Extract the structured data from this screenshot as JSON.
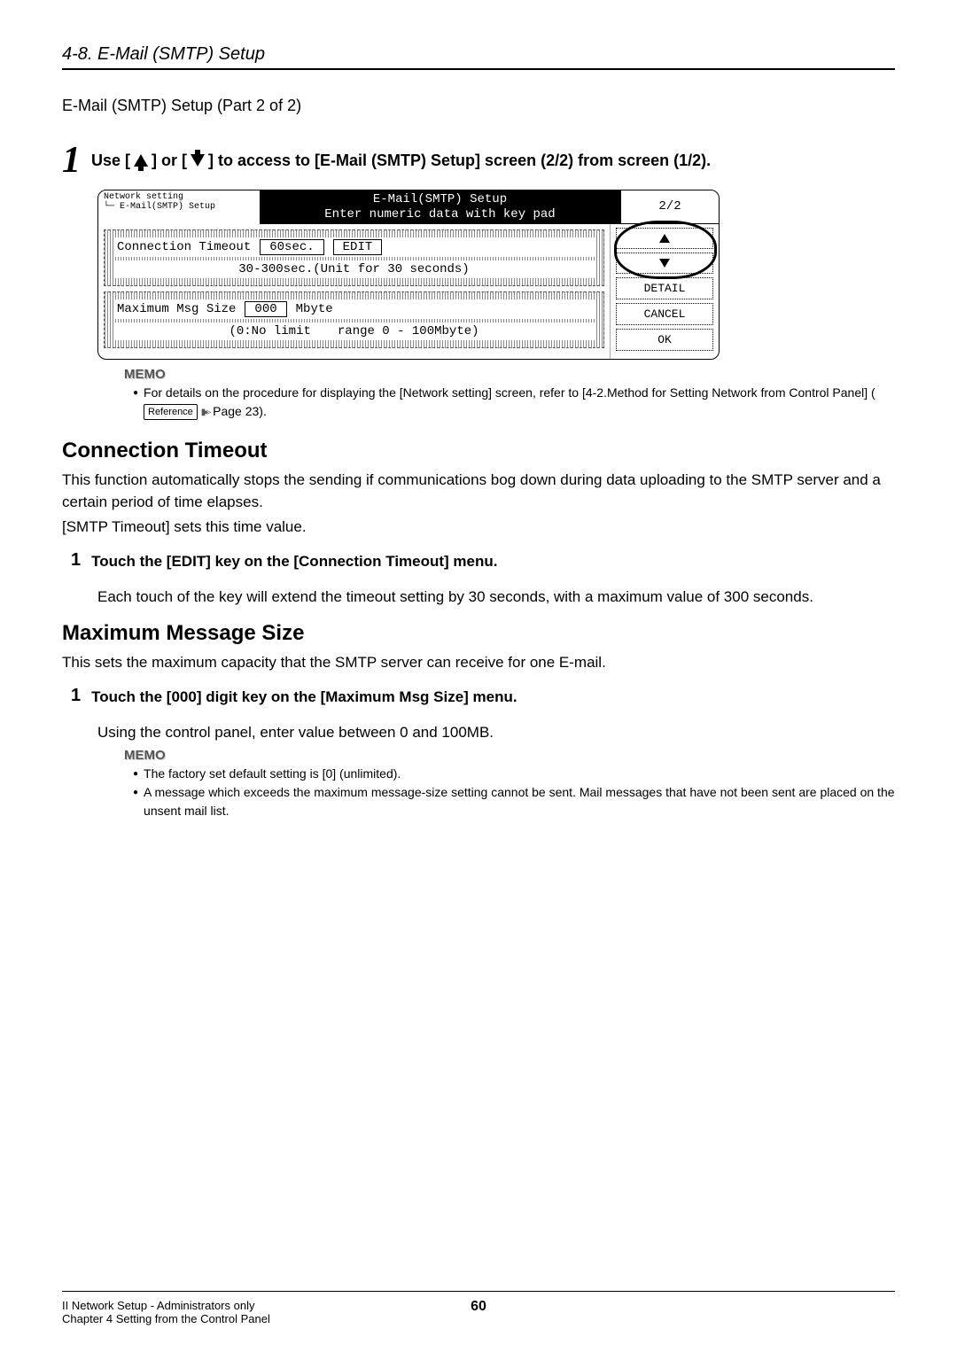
{
  "breadcrumb": "4-8. E-Mail (SMTP) Setup",
  "subtitle": "E-Mail (SMTP) Setup (Part 2 of 2)",
  "step1": {
    "pre": "Use [",
    "mid": "] or [",
    "post": "] to access to [E-Mail (SMTP) Setup] screen (2/2) from screen (1/2)."
  },
  "panel": {
    "header_left_line1": "Network setting",
    "header_left_line2": "└─ E-Mail(SMTP) Setup",
    "header_title_line1": "E-Mail(SMTP) Setup",
    "header_title_line2": "Enter numeric data with key pad",
    "page_indicator": "2/2",
    "row1_label": "Connection Timeout",
    "row1_value": "60sec.",
    "row1_button": "EDIT",
    "row1_hint": "30-300sec.(Unit for 30 seconds)",
    "row2_label": "Maximum Msg Size",
    "row2_value": "000",
    "row2_unit": "Mbyte",
    "row2_hint_left": "(0:No limit",
    "row2_hint_right": "range 0 - 100Mbyte)",
    "side": {
      "detail": "DETAIL",
      "cancel": "CANCEL",
      "ok": "OK"
    }
  },
  "memo1": {
    "label": "MEMO",
    "text_a": "For details on the procedure for displaying the [Network setting] screen, refer to [4-2.Method for Setting Network from Control Panel] (",
    "ref": "Reference",
    "text_b": " Page 23)."
  },
  "connection": {
    "heading": "Connection Timeout",
    "p1": "This function automatically stops the sending if communications bog down during data uploading to the SMTP server and a certain period of time elapses.",
    "p2": "[SMTP Timeout] sets this time value.",
    "step_num": "1",
    "step_title": "Touch the [EDIT] key on the [Connection Timeout] menu.",
    "step_body": "Each touch of the key will extend the timeout setting by 30 seconds, with a maximum value of 300 seconds."
  },
  "maxmsg": {
    "heading": "Maximum Message Size",
    "p1": "This sets the maximum capacity that the SMTP server can receive for one E-mail.",
    "step_num": "1",
    "step_title": "Touch the [000] digit key on the [Maximum Msg Size] menu.",
    "step_body": "Using the control panel, enter value between 0 and 100MB."
  },
  "memo2": {
    "label": "MEMO",
    "b1": "The factory set default setting is [0] (unlimited).",
    "b2": "A message which exceeds the maximum message-size setting cannot be sent. Mail messages that have not been sent are placed on the unsent mail list."
  },
  "footer": {
    "left_line1": "II Network Setup - Administrators only",
    "left_line2": "Chapter 4 Setting from the Control Panel",
    "page": "60"
  }
}
